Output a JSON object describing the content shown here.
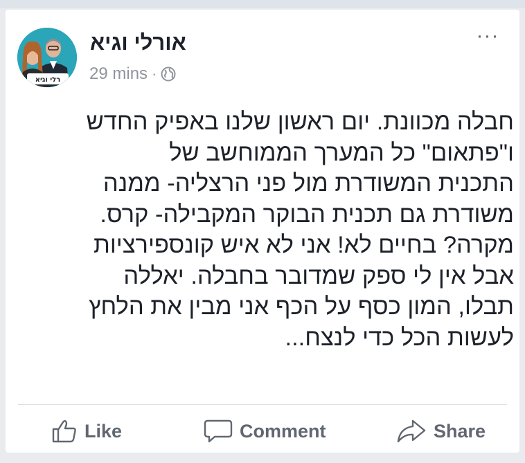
{
  "post": {
    "author": "אורלי וגיא",
    "time": "29 mins",
    "separator": "·",
    "privacy_icon": "globe-icon",
    "more_icon": "more-options-icon",
    "more_label": "···",
    "avatar_caption": "רלי וגיא",
    "body_lines": [
      "חבלה מכוונת. יום ראשון שלנו באפיק החדש",
      "ו\"פתאום\" כל המערך הממוחשב של",
      "התכנית המשודרת מול פני הרצליה- ממנה",
      "משודרת גם תכנית הבוקר המקבילה- קרס.",
      "מקרה? בחיים לא! אני לא איש קונספירציות",
      "אבל אין לי ספק שמדובר בחבלה. יאללה",
      "תבלו, המון כסף על הכף אני מבין את הלחץ",
      "לעשות הכל כדי לנצח..."
    ]
  },
  "actions": {
    "like_label": "Like",
    "comment_label": "Comment",
    "share_label": "Share",
    "like_icon": "thumbs-up-icon",
    "comment_icon": "comment-bubble-icon",
    "share_icon": "share-arrow-icon"
  },
  "colors": {
    "text": "#1d2129",
    "muted": "#90949c",
    "action": "#606770",
    "background": "#e9ebee"
  }
}
